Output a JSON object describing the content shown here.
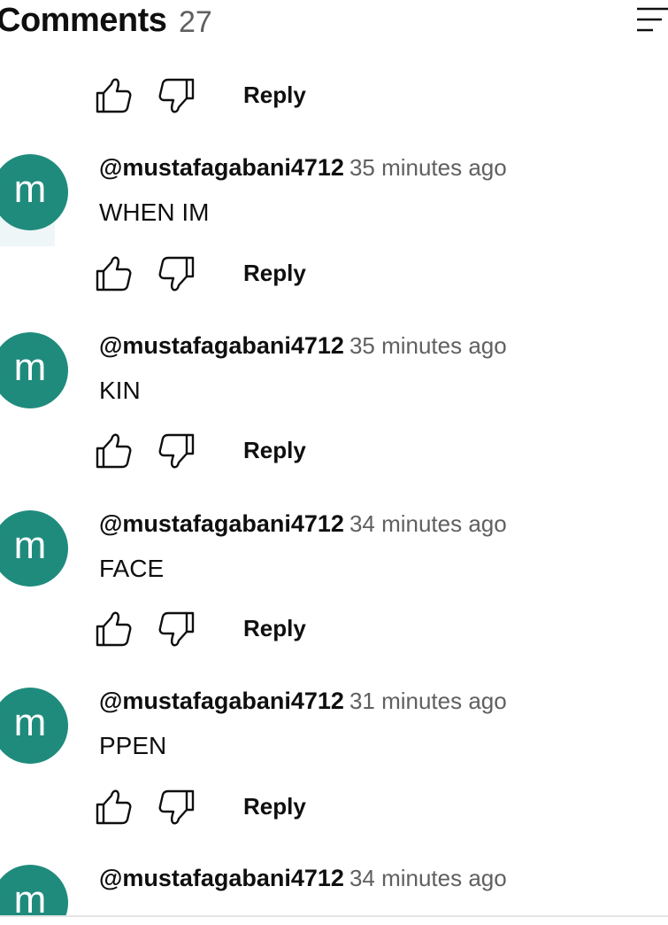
{
  "header": {
    "title": "Comments",
    "count": "27",
    "sort_icon": "sort-icon"
  },
  "reply_label": "Reply",
  "icons": {
    "like": "thumb-up-icon",
    "dislike": "thumb-down-icon"
  },
  "colors": {
    "avatar_bg": "#1f8b7d",
    "secondary_text": "#606060"
  },
  "comments": [
    {
      "avatar_letter": "m",
      "author": "@mustafagabani4712",
      "time": "35 minutes ago",
      "text": "WHEN IM"
    },
    {
      "avatar_letter": "m",
      "author": "@mustafagabani4712",
      "time": "35 minutes ago",
      "text": "KIN"
    },
    {
      "avatar_letter": "m",
      "author": "@mustafagabani4712",
      "time": "34 minutes ago",
      "text": "FACE"
    },
    {
      "avatar_letter": "m",
      "author": "@mustafagabani4712",
      "time": "31 minutes ago",
      "text": "PPEN"
    },
    {
      "avatar_letter": "m",
      "author": "@mustafagabani4712",
      "time": "34 minutes ago",
      "text": ""
    }
  ]
}
